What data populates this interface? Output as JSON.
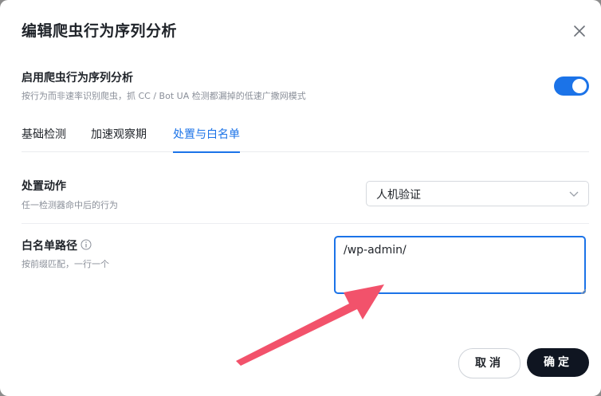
{
  "dialog": {
    "title": "编辑爬虫行为序列分析"
  },
  "enable": {
    "label": "启用爬虫行为序列分析",
    "description": "按行为而非速率识别爬虫，抓 CC / Bot UA 检测都漏掉的低速广撒网模式",
    "enabled": true
  },
  "tabs": [
    {
      "label": "基础检测",
      "active": false
    },
    {
      "label": "加速观察期",
      "active": false
    },
    {
      "label": "处置与白名单",
      "active": true
    }
  ],
  "action": {
    "label": "处置动作",
    "description": "任一检测器命中后的行为",
    "selected": "人机验证"
  },
  "whitelist": {
    "label": "白名单路径",
    "description": "按前缀匹配，一行一个",
    "value": "/wp-admin/"
  },
  "buttons": {
    "cancel": "取消",
    "ok": "确定"
  },
  "colors": {
    "accent": "#1b73e8",
    "primary_button": "#0f1521",
    "annotation_arrow": "#f2526b"
  }
}
